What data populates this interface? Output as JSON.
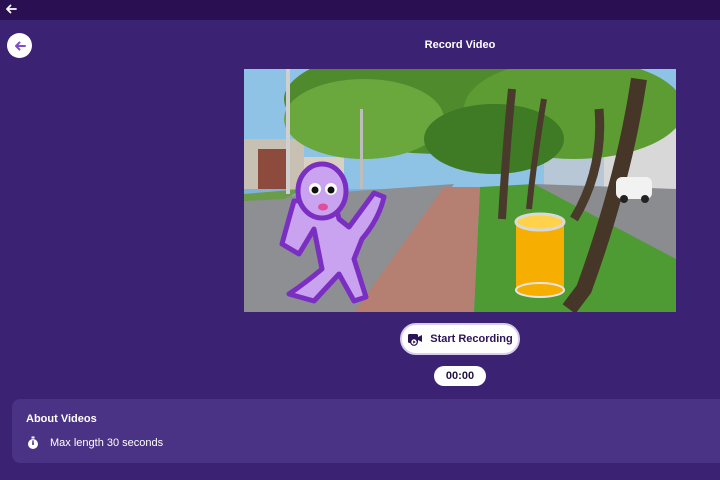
{
  "header": {
    "title": "Record Video",
    "back_icon": "arrow-left-icon"
  },
  "recorder": {
    "start_label": "Start Recording",
    "start_icon": "video-camera-icon",
    "timer": "00:00"
  },
  "about": {
    "title": "About Videos",
    "items": [
      {
        "icon": "stopwatch-icon",
        "text": "Max length 30 seconds"
      }
    ]
  },
  "colors": {
    "background": "#3b2273",
    "topbar": "#2a0f52",
    "card": "#4a3384",
    "accent": "#7b4fd0"
  }
}
